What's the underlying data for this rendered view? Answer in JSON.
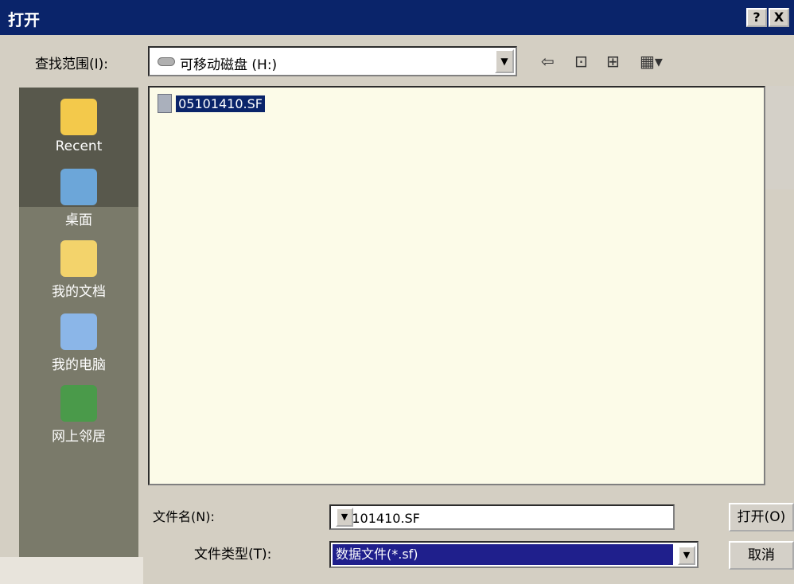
{
  "window": {
    "title": "打开",
    "help_label": "?",
    "close_label": "X"
  },
  "look_in": {
    "label": "查找范围(I):",
    "value": "可移动磁盘 (H:)",
    "icon": "removable-drive-icon"
  },
  "toolbar": [
    {
      "name": "back-icon",
      "glyph": "⇦"
    },
    {
      "name": "up-folder-icon",
      "glyph": "⊡"
    },
    {
      "name": "new-folder-icon",
      "glyph": "⊞"
    },
    {
      "name": "view-menu-icon",
      "glyph": "▦▾"
    }
  ],
  "sidebar": {
    "items": [
      {
        "label": "Recent",
        "icon": "recent-folder-icon",
        "color": "#f3c94b"
      },
      {
        "label": "桌面",
        "icon": "desktop-icon",
        "color": "#6ca6d9"
      },
      {
        "label": "我的文档",
        "icon": "my-documents-icon",
        "color": "#f3d36b"
      },
      {
        "label": "我的电脑",
        "icon": "my-computer-icon",
        "color": "#8bb6e8"
      },
      {
        "label": "网上邻居",
        "icon": "network-icon",
        "color": "#4a9a4a"
      }
    ]
  },
  "files": [
    {
      "name": "05101410.SF",
      "selected": true
    }
  ],
  "file_name": {
    "label": "文件名(N):",
    "value": "05101410.SF"
  },
  "file_type": {
    "label": "文件类型(T):",
    "value": "数据文件(*.sf)"
  },
  "buttons": {
    "open": "打开(O)",
    "cancel": "取消"
  }
}
